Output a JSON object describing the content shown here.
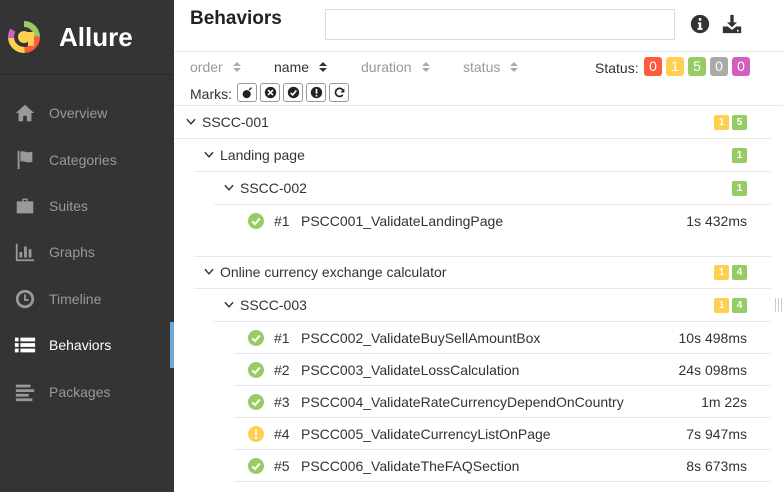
{
  "app": {
    "name": "Allure"
  },
  "nav": [
    {
      "label": "Overview",
      "icon": "home-icon",
      "active": false
    },
    {
      "label": "Categories",
      "icon": "flag-icon",
      "active": false
    },
    {
      "label": "Suites",
      "icon": "briefcase-icon",
      "active": false
    },
    {
      "label": "Graphs",
      "icon": "bar-chart-icon",
      "active": false
    },
    {
      "label": "Timeline",
      "icon": "clock-icon",
      "active": false
    },
    {
      "label": "Behaviors",
      "icon": "list-icon",
      "active": true
    },
    {
      "label": "Packages",
      "icon": "align-left-icon",
      "active": false
    }
  ],
  "header": {
    "title": "Behaviors",
    "search_value": ""
  },
  "sort": {
    "order": "order",
    "name": "name",
    "duration": "duration",
    "status": "status"
  },
  "status_filter": {
    "label": "Status:",
    "counts": {
      "failed": "0",
      "broken": "1",
      "passed": "5",
      "skipped": "0",
      "unknown": "0"
    }
  },
  "marks_label": "Marks:",
  "colors": {
    "passed": "#97cc64",
    "broken": "#ffd050",
    "failed": "#fd5a3e",
    "skipped": "#aaaaaa",
    "unknown": "#d35ebe",
    "accent": "#6da7d5"
  },
  "tree": {
    "epic": {
      "name": "SSCC-001",
      "broken": "1",
      "passed": "5"
    },
    "feature1": {
      "name": "Landing page",
      "passed": "1"
    },
    "story1": {
      "name": "SSCC-002",
      "passed": "1"
    },
    "tests1": [
      {
        "num": "#1",
        "name": "PSCC001_ValidateLandingPage",
        "duration": "1s 432ms",
        "status": "passed"
      }
    ],
    "feature2": {
      "name": "Online currency exchange calculator",
      "broken": "1",
      "passed": "4"
    },
    "story2": {
      "name": "SSCC-003",
      "broken": "1",
      "passed": "4"
    },
    "tests2": [
      {
        "num": "#1",
        "name": "PSCC002_ValidateBuySellAmountBox",
        "duration": "10s 498ms",
        "status": "passed"
      },
      {
        "num": "#2",
        "name": "PSCC003_ValidateLossCalculation",
        "duration": "24s 098ms",
        "status": "passed"
      },
      {
        "num": "#3",
        "name": "PSCC004_ValidateRateCurrencyDependOnCountry",
        "duration": "1m 22s",
        "status": "passed"
      },
      {
        "num": "#4",
        "name": "PSCC005_ValidateCurrencyListOnPage",
        "duration": "7s 947ms",
        "status": "broken"
      },
      {
        "num": "#5",
        "name": "PSCC006_ValidateTheFAQSection",
        "duration": "8s 673ms",
        "status": "passed"
      }
    ]
  }
}
